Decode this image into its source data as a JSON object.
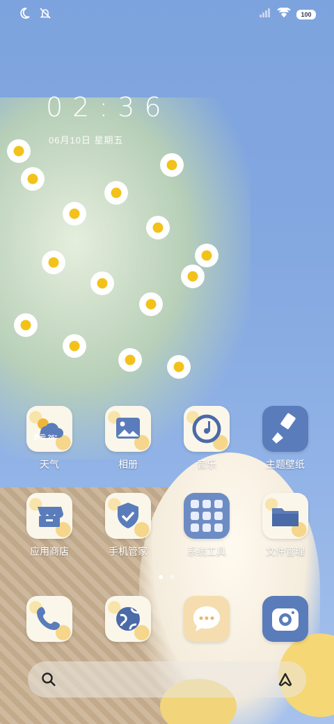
{
  "status_bar": {
    "left_icons": [
      "moon-icon",
      "mute-icon"
    ],
    "right_icons": [
      "signal-icon",
      "wifi-icon"
    ],
    "battery": "100"
  },
  "clock": {
    "time": "02:36",
    "date": "06月10日 星期五"
  },
  "apps": [
    {
      "label": "天气",
      "icon": "weather-icon",
      "sub": "多云 26°"
    },
    {
      "label": "相册",
      "icon": "gallery-icon"
    },
    {
      "label": "音乐",
      "icon": "music-icon"
    },
    {
      "label": "主题壁纸",
      "icon": "brush-icon"
    },
    {
      "label": "应用商店",
      "icon": "store-icon"
    },
    {
      "label": "手机管家",
      "icon": "shield-icon"
    },
    {
      "label": "系统工具",
      "icon": "folder-grid-icon"
    },
    {
      "label": "文件管理",
      "icon": "file-icon"
    }
  ],
  "dock": [
    {
      "icon": "phone-icon"
    },
    {
      "icon": "browser-icon"
    },
    {
      "icon": "message-icon"
    },
    {
      "icon": "camera-icon"
    }
  ],
  "page_indicator": {
    "count": 2,
    "active": 1
  }
}
